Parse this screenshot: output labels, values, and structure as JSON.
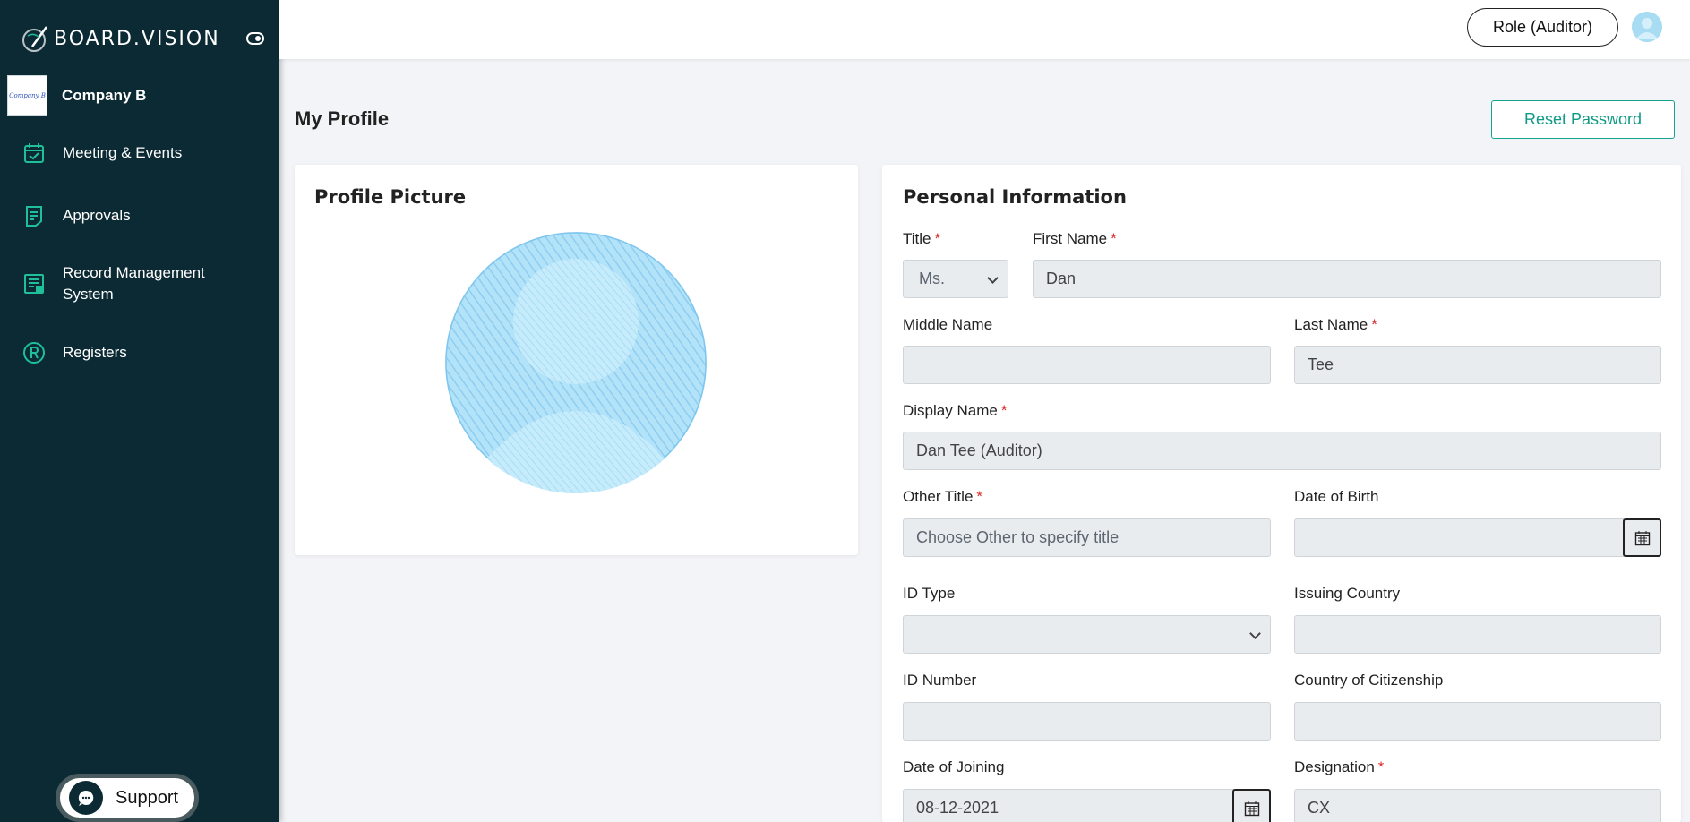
{
  "brand": {
    "name": "BOARD.VISION"
  },
  "company": {
    "logo_text": "Company B",
    "name": "Company B"
  },
  "nav": [
    {
      "label": "Meeting & Events",
      "icon": "calendar-check-icon"
    },
    {
      "label": "Approvals",
      "icon": "document-list-icon"
    },
    {
      "label": "Record Management System",
      "icon": "records-icon"
    },
    {
      "label": "Registers",
      "icon": "registered-icon"
    }
  ],
  "support": {
    "label": "Support"
  },
  "header": {
    "role_label": "Role (Auditor)"
  },
  "page": {
    "title": "My Profile",
    "reset_password_label": "Reset Password"
  },
  "profile_card": {
    "title": "Profile Picture"
  },
  "personal_info": {
    "title": "Personal Information",
    "fields": {
      "title": {
        "label": "Title",
        "value": "Ms.",
        "required": "*"
      },
      "first_name": {
        "label": "First Name",
        "value": "Dan",
        "required": "*"
      },
      "middle_name": {
        "label": "Middle Name",
        "value": ""
      },
      "last_name": {
        "label": "Last Name",
        "value": "Tee",
        "required": "*"
      },
      "display_name": {
        "label": "Display Name",
        "value": "Dan Tee (Auditor)",
        "required": "*"
      },
      "other_title": {
        "label": "Other Title",
        "placeholder": "Choose Other to specify title",
        "required": "*"
      },
      "date_of_birth": {
        "label": "Date of Birth",
        "value": ""
      },
      "id_type": {
        "label": "ID Type",
        "value": ""
      },
      "issuing_country": {
        "label": "Issuing Country",
        "value": ""
      },
      "id_number": {
        "label": "ID Number",
        "value": ""
      },
      "country_of_citizenship": {
        "label": "Country of Citizenship",
        "value": ""
      },
      "date_of_joining": {
        "label": "Date of Joining",
        "value": "08-12-2021"
      },
      "designation": {
        "label": "Designation",
        "value": "CX",
        "required": "*"
      }
    }
  },
  "colors": {
    "sidebar": "#0c2a33",
    "accent": "#13a38f",
    "required": "#d92b2b"
  }
}
